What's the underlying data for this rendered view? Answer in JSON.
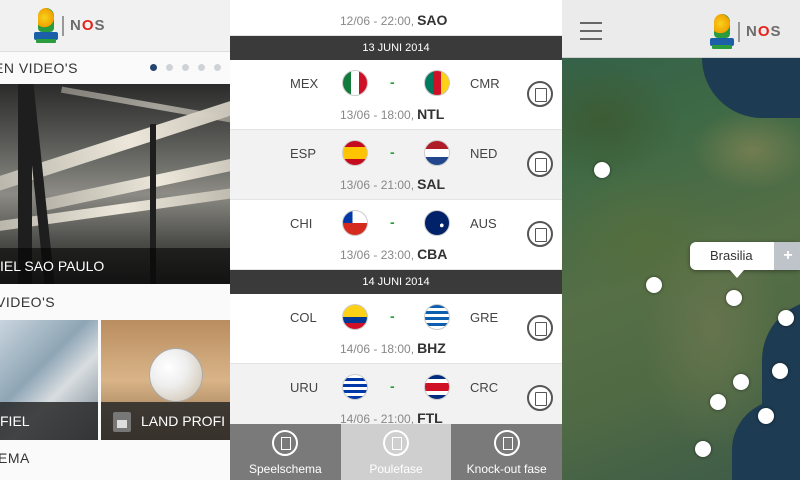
{
  "brand": {
    "partner_logo": "NOS"
  },
  "videos": {
    "top_section": "EN VIDEO'S",
    "carousel_dots": 5,
    "carousel_active_index": 0,
    "hero_caption": "IEL SAO PAULO",
    "second_section": "VIDEO'S",
    "thumb_left_caption": "FIEL",
    "thumb_right_caption": "LAND PROFI",
    "third_section": "EMA"
  },
  "schedule": {
    "prev_match_when": "12/06 - 22:00,",
    "prev_match_venue": "SAO",
    "days": [
      {
        "date": "13 JUNI 2014",
        "matches": [
          {
            "home": "MEX",
            "away": "CMR",
            "when": "13/06 - 18:00,",
            "venue": "NTL"
          },
          {
            "home": "ESP",
            "away": "NED",
            "when": "13/06 - 21:00,",
            "venue": "SAL"
          },
          {
            "home": "CHI",
            "away": "AUS",
            "when": "13/06 - 23:00,",
            "venue": "CBA"
          }
        ]
      },
      {
        "date": "14 JUNI 2014",
        "matches": [
          {
            "home": "COL",
            "away": "GRE",
            "when": "14/06 - 18:00,",
            "venue": "BHZ"
          },
          {
            "home": "URU",
            "away": "CRC",
            "when": "14/06 - 21:00,",
            "venue": "FTL"
          }
        ]
      }
    ],
    "vs_sign": "-",
    "tabs": [
      {
        "label": "Speelschema",
        "icon": "calendar-icon"
      },
      {
        "label": "Poulefase",
        "icon": "group-icon"
      },
      {
        "label": "Knock-out fase",
        "icon": "bracket-icon"
      }
    ],
    "active_tab": "Poulefase"
  },
  "map": {
    "callout_label": "Brasilia",
    "callout_action": "+",
    "pins_count": 9
  },
  "colors": {
    "accent_green": "#2b9c3d",
    "dark_header": "#3a3a3a",
    "tab_bar": "#7a7a7a",
    "active_dot": "#24446e"
  }
}
